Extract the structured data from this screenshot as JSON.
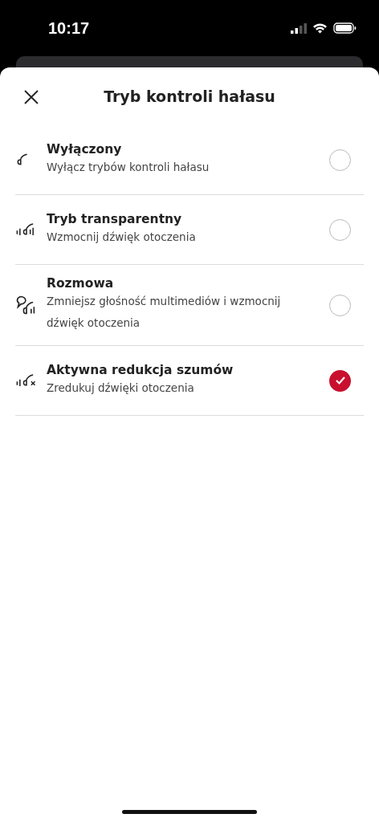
{
  "status_bar": {
    "time": "10:17"
  },
  "sheet": {
    "title": "Tryb kontroli hałasu"
  },
  "options": [
    {
      "kind": "off",
      "title": "Wyłączony",
      "subtitle": "Wyłącz trybów kontroli hałasu",
      "selected": false
    },
    {
      "kind": "transparent",
      "title": "Tryb transparentny",
      "subtitle": "Wzmocnij dźwięk otoczenia",
      "selected": false
    },
    {
      "kind": "conversation",
      "title": "Rozmowa",
      "subtitle": "Zmniejsz głośność multimediów i wzmocnij dźwięk otoczenia",
      "selected": false
    },
    {
      "kind": "anc",
      "title": "Aktywna redukcja szumów",
      "subtitle": "Zredukuj dźwięki otoczenia",
      "selected": true
    }
  ]
}
